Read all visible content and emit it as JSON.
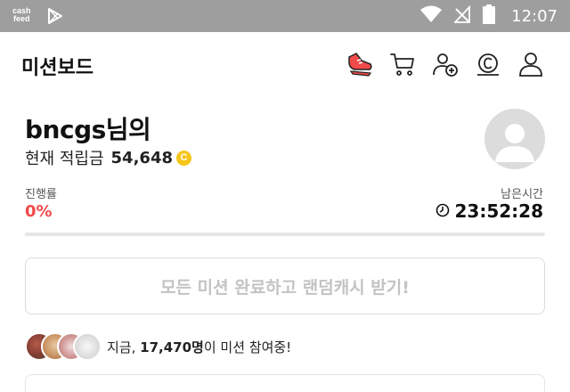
{
  "status_bar": {
    "app_badge_line1": "cash",
    "app_badge_line2": "feed",
    "time": "12:07",
    "icons": [
      "play-store-icon",
      "wifi-icon",
      "no-signal-icon",
      "battery-icon"
    ]
  },
  "header": {
    "title": "미션보드",
    "icons": [
      "shoe-icon",
      "cart-icon",
      "add-friend-icon",
      "cash-coin-icon",
      "profile-icon"
    ]
  },
  "profile": {
    "username": "bncgs님의",
    "points_label": "현재 적립금",
    "points_value": "54,648",
    "coin_symbol": "C"
  },
  "progress": {
    "label": "진행률",
    "value": "0%",
    "fraction": 0,
    "remaining_label": "남은시간",
    "remaining_value": "23:52:28"
  },
  "claim_button": {
    "label": "모든 미션 완료하고 랜덤캐시 받기!"
  },
  "participants": {
    "prefix": "지금,",
    "count": "17,470명",
    "suffix": "이 미션 참여중!"
  },
  "colors": {
    "status_bar_bg": "#9e9e9e",
    "accent_red": "#f04a4a",
    "coin_yellow": "#f5c518",
    "disabled_text": "#c3c3c3"
  }
}
